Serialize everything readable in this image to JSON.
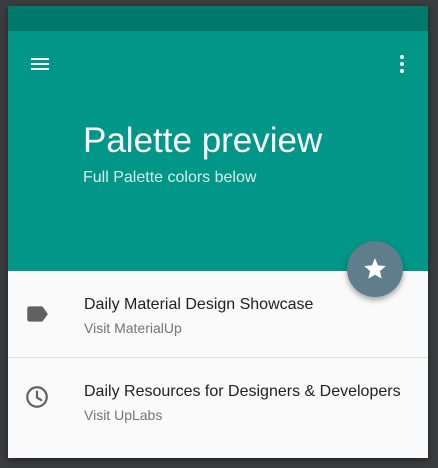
{
  "header": {
    "title": "Palette preview",
    "subtitle": "Full Palette colors below",
    "menu_icon": "menu-icon",
    "more_icon": "more-vert-icon"
  },
  "fab": {
    "icon": "star-icon"
  },
  "list": {
    "items": [
      {
        "icon": "label-icon",
        "title": "Daily Material Design Showcase",
        "subtitle": "Visit MaterialUp"
      },
      {
        "icon": "clock-icon",
        "title": "Daily Resources for Designers & Developers",
        "subtitle": "Visit UpLabs"
      }
    ]
  },
  "colors": {
    "status_bar": "#00796b",
    "primary": "#009688",
    "fab": "#607d8b",
    "background": "#fafafa",
    "icon": "#616161"
  }
}
